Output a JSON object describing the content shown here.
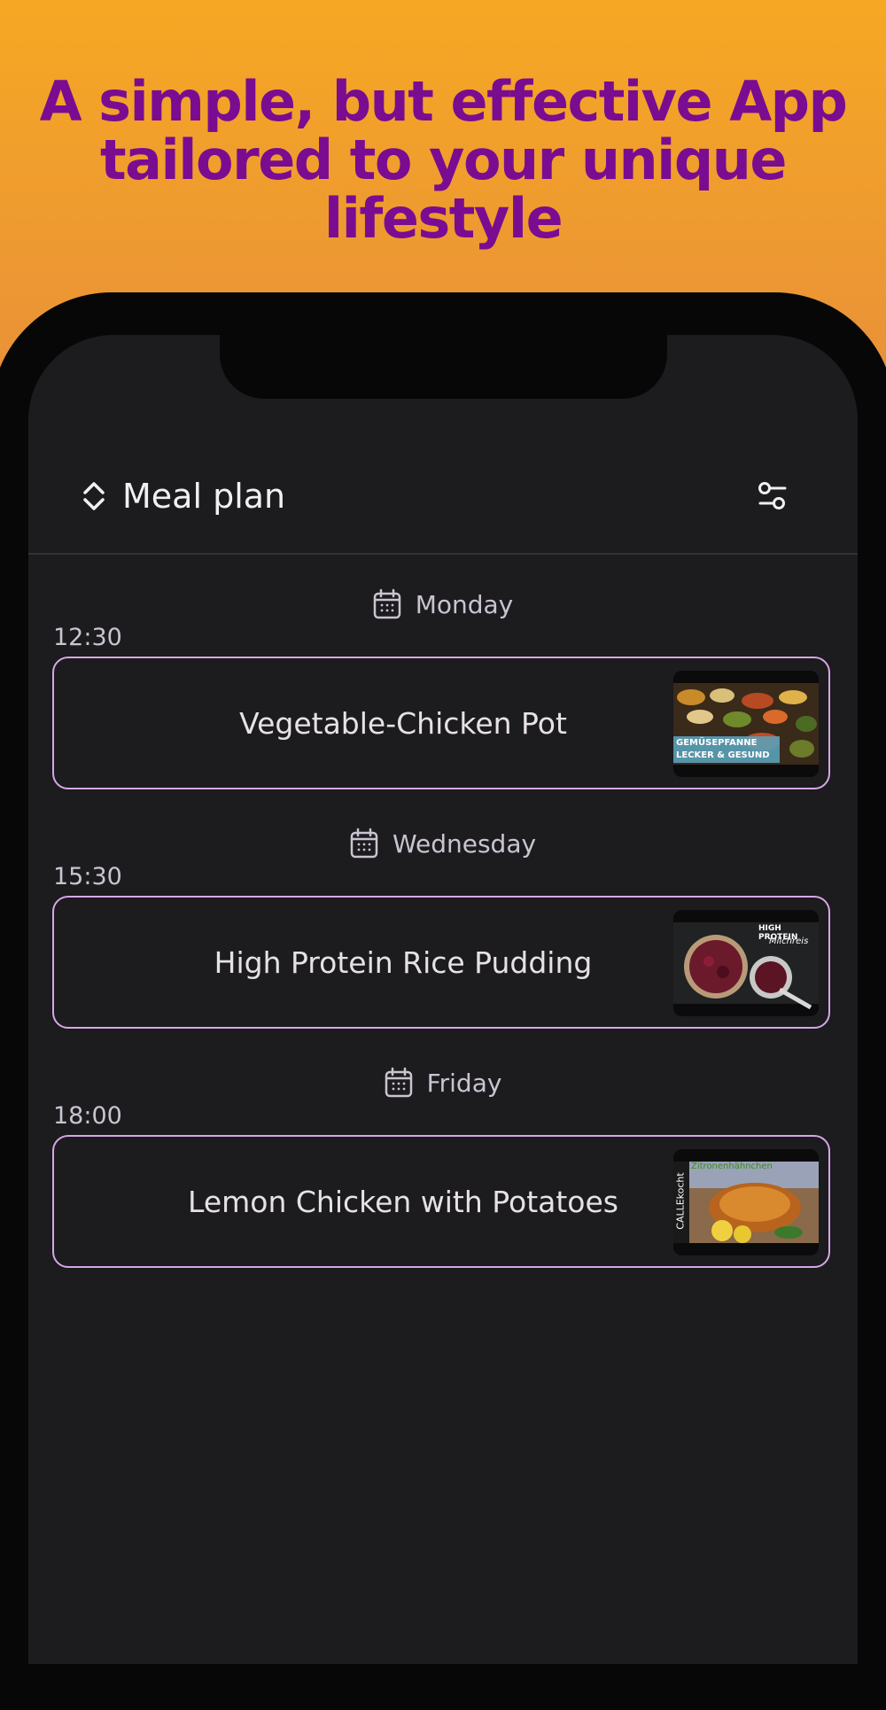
{
  "headline": {
    "line1": "A simple, but effective App",
    "line2": "tailored to your unique",
    "line3": "lifestyle"
  },
  "appbar": {
    "title": "Meal plan",
    "sort_icon": "unfold-more-icon",
    "filter_icon": "tune-icon"
  },
  "meals": [
    {
      "day": "Monday",
      "time": "12:30",
      "name": "Vegetable-Chicken Pot",
      "thumb_caption_1": "GEMÜSEPFANNE",
      "thumb_caption_2": "LECKER & GESUND"
    },
    {
      "day": "Wednesday",
      "time": "15:30",
      "name": "High Protein Rice Pudding",
      "thumb_caption_1": "HIGH PROTEIN",
      "thumb_caption_2": "Milchreis"
    },
    {
      "day": "Friday",
      "time": "18:00",
      "name": "Lemon Chicken with Potatoes",
      "thumb_caption_1": "Zitronenhähnchen",
      "thumb_caption_2": "CALLEkocht"
    }
  ],
  "colors": {
    "headline": "#7a0c92",
    "card_border": "#d8a6e6",
    "screen_bg": "#1c1b1e"
  }
}
